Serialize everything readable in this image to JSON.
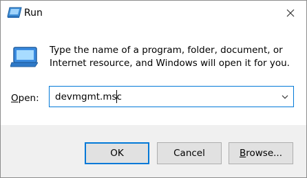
{
  "window": {
    "title": "Run",
    "close_glyph": "✕"
  },
  "content": {
    "description": "Type the name of a program, folder, document, or Internet resource, and Windows will open it for you.",
    "open_label_accel": "O",
    "open_label_rest": "pen:",
    "open_value": "devmgmt.msc"
  },
  "buttons": {
    "ok": "OK",
    "cancel": "Cancel",
    "browse_accel": "B",
    "browse_rest": "rowse..."
  },
  "icons": {
    "app": "run-icon",
    "close": "close-icon",
    "dropdown": "chevron-down-icon"
  },
  "colors": {
    "accent": "#0078d7",
    "button_bg": "#e1e1e1",
    "footer_bg": "#f0f0f0"
  }
}
